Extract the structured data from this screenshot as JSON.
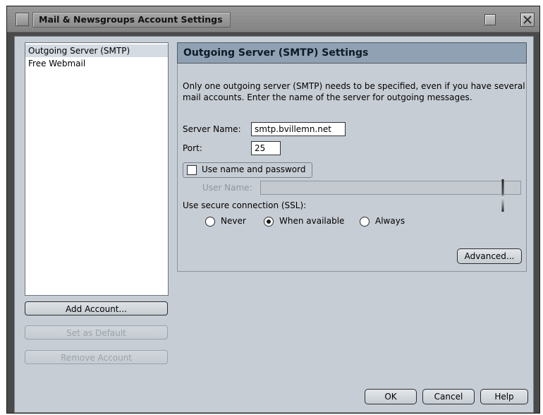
{
  "window": {
    "title": "Mail & Newsgroups Account Settings"
  },
  "accounts": {
    "items": [
      {
        "label": "Outgoing Server (SMTP)",
        "selected": true
      },
      {
        "label": "Free Webmail",
        "selected": false
      }
    ],
    "add_label": "Add Account...",
    "set_default_label": "Set as Default",
    "remove_label": "Remove Account"
  },
  "settings": {
    "header": "Outgoing Server (SMTP) Settings",
    "description": "Only one outgoing server (SMTP) needs to be specified, even if you have several mail accounts. Enter the name of the server for outgoing messages.",
    "server_name_label": "Server Name:",
    "server_name_value": "smtp.bvillemn.net",
    "port_label": "Port:",
    "port_value": "25",
    "use_auth_label": "Use name and password",
    "use_auth_checked": false,
    "user_name_label": "User Name:",
    "user_name_value": "",
    "ssl_label": "Use secure connection (SSL):",
    "ssl_options": [
      {
        "label": "Never",
        "checked": false
      },
      {
        "label": "When available",
        "checked": true
      },
      {
        "label": "Always",
        "checked": false
      }
    ],
    "advanced_label": "Advanced..."
  },
  "footer": {
    "ok_label": "OK",
    "cancel_label": "Cancel",
    "help_label": "Help"
  },
  "icons": {
    "menu": "window-menu-icon",
    "maximize": "maximize-icon",
    "close": "close-icon",
    "resize": "drag-handle-icon"
  }
}
